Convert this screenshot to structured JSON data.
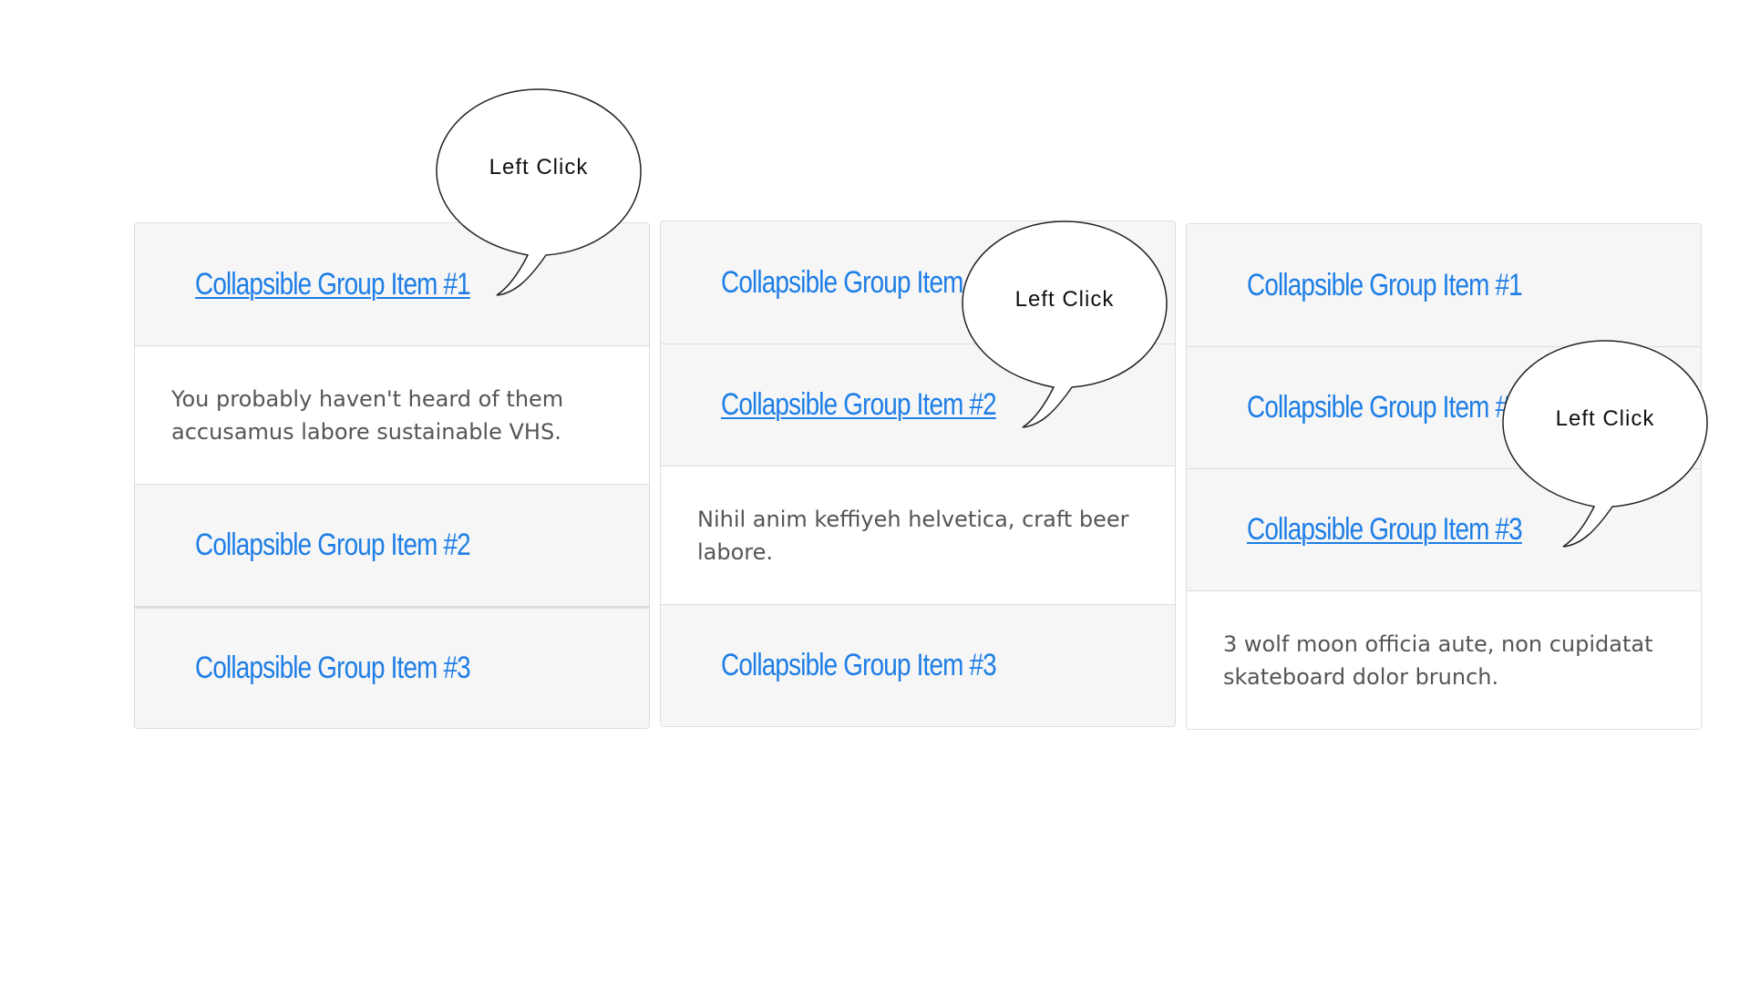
{
  "panels": [
    {
      "items": [
        {
          "title": "Collapsible Group Item #1",
          "open": true,
          "body": "You probably haven't heard of them accusamus labore sustainable VHS."
        },
        {
          "title": "Collapsible Group Item #2",
          "open": false
        },
        {
          "title": "Collapsible Group Item #3",
          "open": false
        }
      ],
      "callout": "Left Click"
    },
    {
      "items": [
        {
          "title": "Collapsible Group Item #1",
          "open": false
        },
        {
          "title": "Collapsible Group Item #2",
          "open": true,
          "body": "Nihil anim keffiyeh helvetica, craft beer labore."
        },
        {
          "title": "Collapsible Group Item #3",
          "open": false
        }
      ],
      "callout": "Left Click"
    },
    {
      "items": [
        {
          "title": "Collapsible Group Item #1",
          "open": false
        },
        {
          "title": "Collapsible Group Item #2",
          "open": false
        },
        {
          "title": "Collapsible Group Item #3",
          "open": true,
          "body": "3 wolf moon officia aute, non cupidatat skateboard dolor brunch."
        }
      ],
      "callout": "Left Click"
    }
  ],
  "colors": {
    "link": "#1e7ee6",
    "header_bg": "#f6f6f6",
    "border": "#dddddd",
    "body_text": "#555555"
  }
}
